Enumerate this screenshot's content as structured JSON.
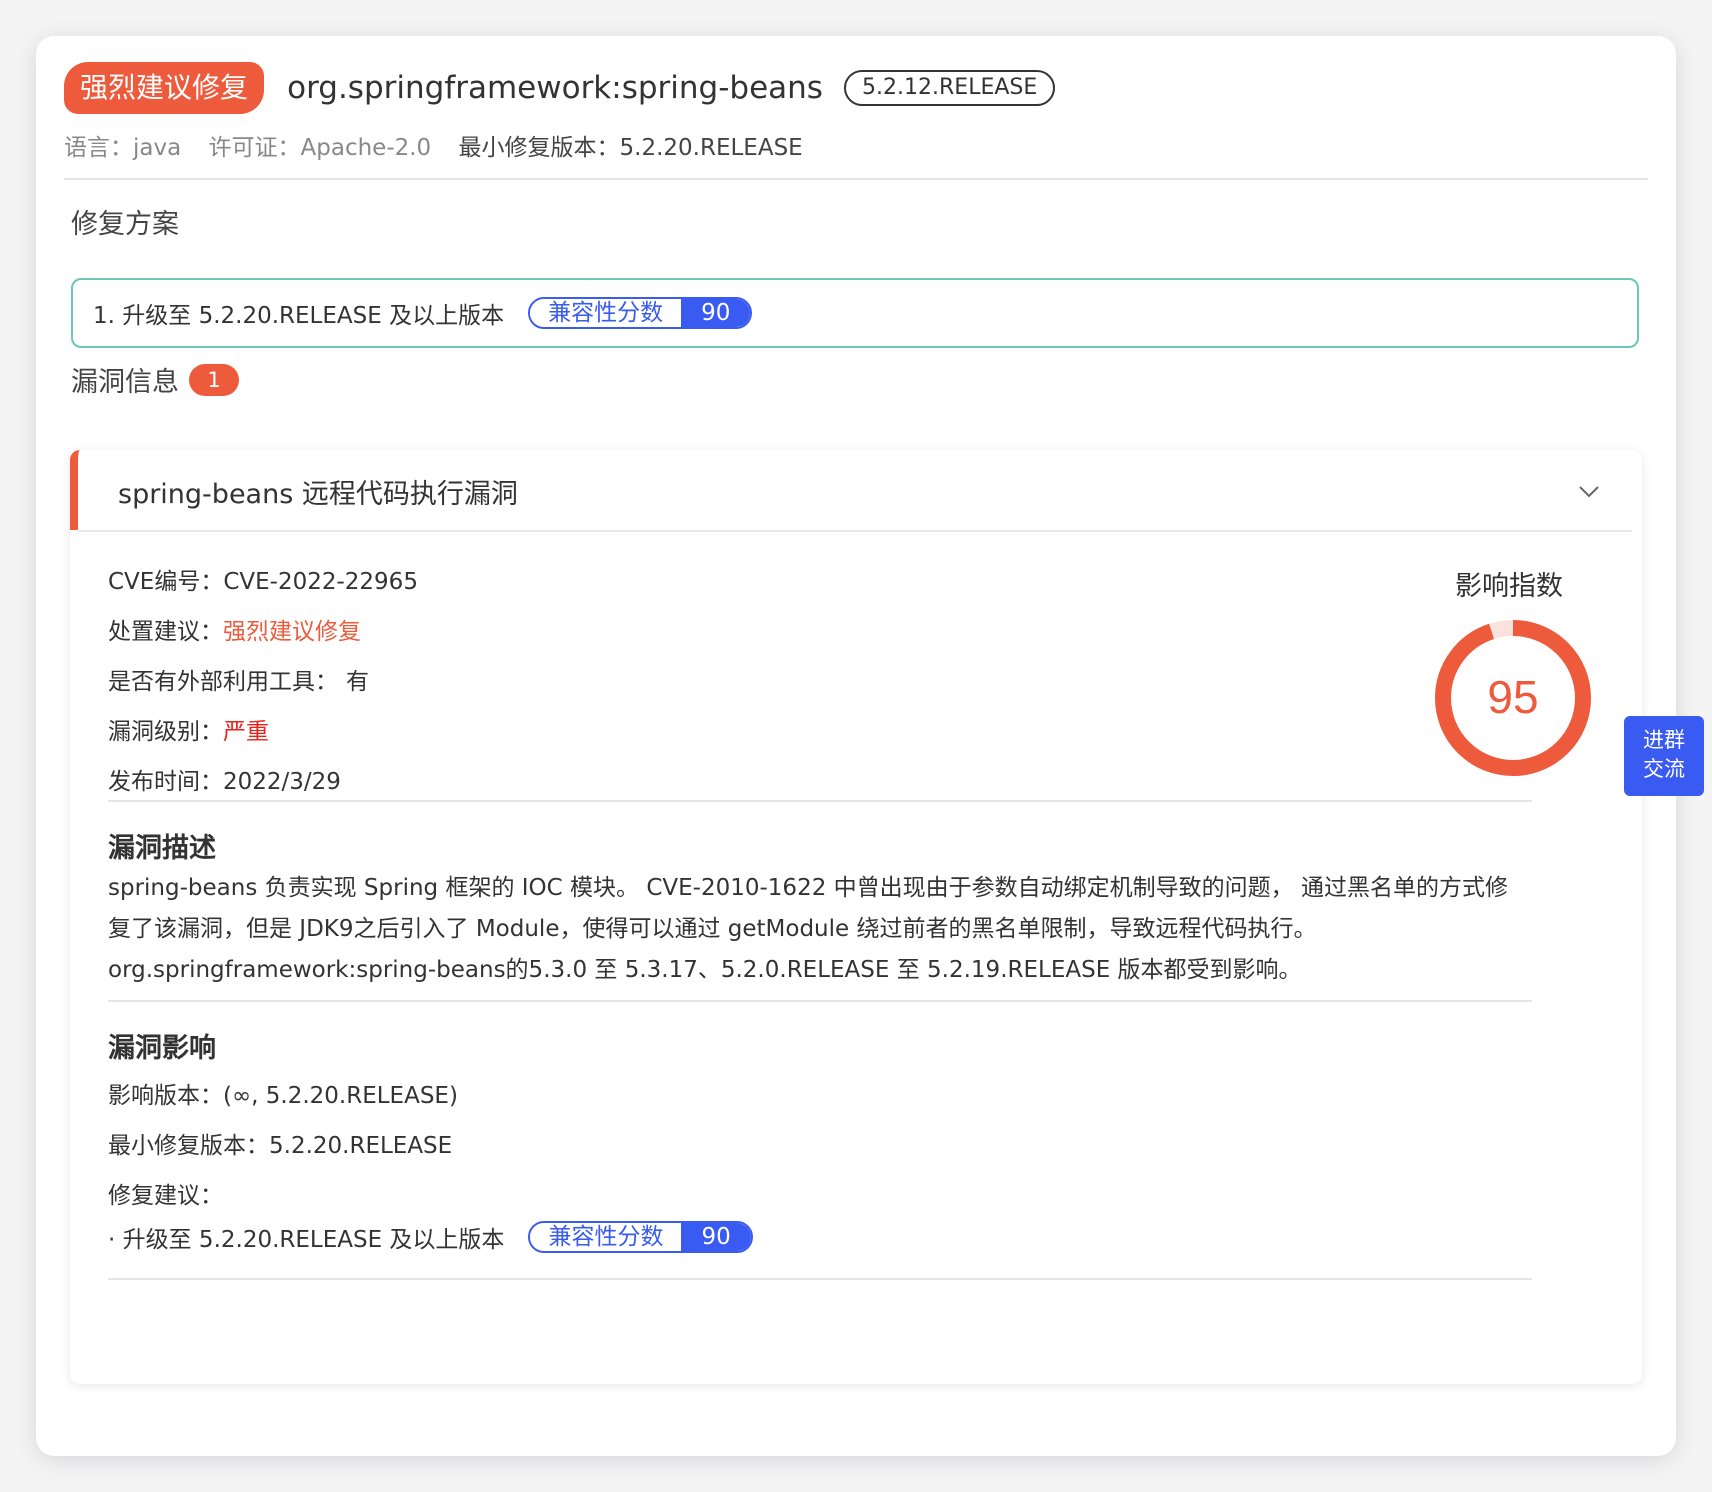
{
  "header": {
    "severity_badge": "强烈建议修复",
    "package": "org.springframework:spring-beans",
    "version": "5.2.12.RELEASE",
    "language": "语言：java",
    "license": "许可证：Apache-2.0",
    "min_fix_version": "最小修复版本：5.2.20.RELEASE"
  },
  "fix_plan": {
    "title": "修复方案",
    "item": "1. 升级至 5.2.20.RELEASE 及以上版本",
    "compat_label": "兼容性分数",
    "compat_score": "90"
  },
  "vuln_section": {
    "title": "漏洞信息",
    "count": "1"
  },
  "vuln": {
    "title": "spring-beans 远程代码执行漏洞",
    "cve_label": "CVE编号：",
    "cve": "CVE-2022-22965",
    "advice_label": "处置建议：",
    "advice": "强烈建议修复",
    "exploit_label": "是否有外部利用工具：",
    "exploit": "有",
    "level_label": "漏洞级别：",
    "level": "严重",
    "date_label": "发布时间：",
    "date": "2022/3/29",
    "impact_label": "影响指数",
    "impact_score": "95",
    "desc_title": "漏洞描述",
    "desc_line1": "spring-beans 负责实现 Spring 框架的 IOC 模块。 CVE-2010-1622 中曾出现由于参数自动绑定机制导致的问题， 通过黑名单的方式修",
    "desc_line2": "复了该漏洞，但是 JDK9之后引入了 Module，使得可以通过 getModule 绕过前者的黑名单限制，导致远程代码执行。",
    "desc_line3": "org.springframework:spring-beans的5.3.0 至 5.3.17、5.2.0.RELEASE 至 5.2.19.RELEASE 版本都受到影响。",
    "effect_title": "漏洞影响",
    "affected_versions": "影响版本：(∞, 5.2.20.RELEASE)",
    "min_fix": "最小修复版本：5.2.20.RELEASE",
    "fix_advice_label": "修复建议：",
    "fix_advice_item": "· 升级至 5.2.20.RELEASE 及以上版本",
    "compat_label": "兼容性分数",
    "compat_score": "90"
  },
  "float_button": {
    "line1": "进群",
    "line2": "交流"
  },
  "colors": {
    "severity": "#ee5a3c",
    "critical": "#e8211b",
    "accent": "#3a5bf2",
    "fix_border": "#6cc7b4"
  },
  "icons": {
    "collapse": "chevron-down-icon"
  }
}
